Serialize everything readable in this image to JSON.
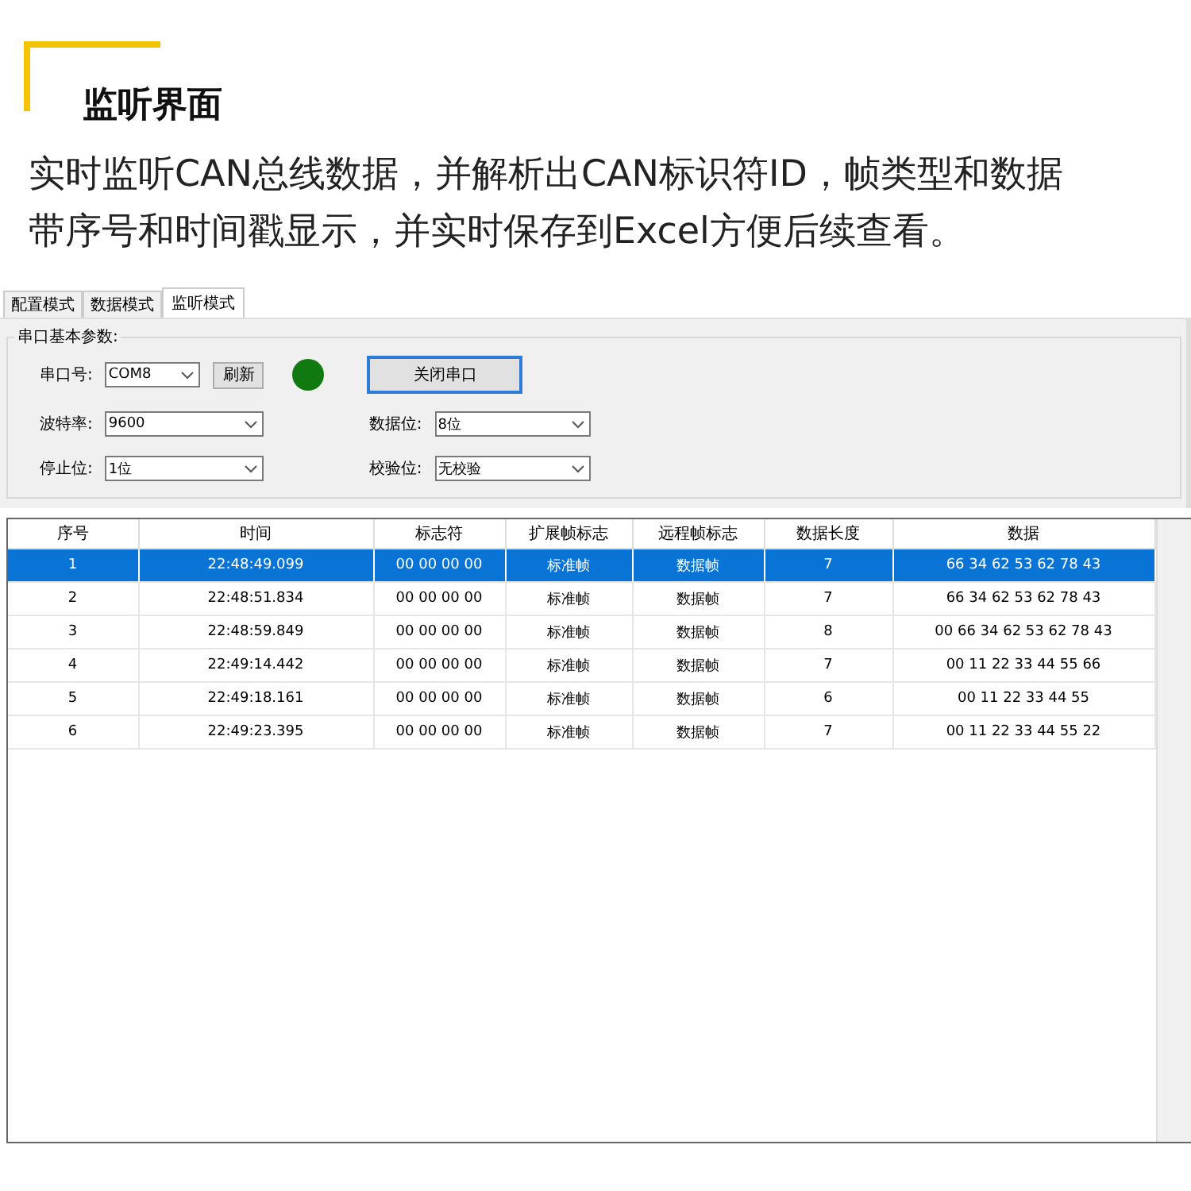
{
  "heading": {
    "title": "监听界面"
  },
  "description": {
    "lines": [
      "实时监听CAN总线数据，并解析出CAN标识符ID，帧类型和数据",
      "带序号和时间戳显示，并实时保存到Excel方便后续查看。"
    ]
  },
  "tabs": [
    {
      "label": "配置模式",
      "selected": false
    },
    {
      "label": "数据模式",
      "selected": false
    },
    {
      "label": "监听模式",
      "selected": true
    }
  ],
  "serial_group": {
    "title": "串口基本参数:",
    "port": {
      "label": "串口号:",
      "value": "COM8"
    },
    "refresh_button": "刷新",
    "connected": true,
    "close_button": "关闭串口",
    "baud_rate": {
      "label": "波特率:",
      "value": "9600"
    },
    "data_bits": {
      "label": "数据位:",
      "value": "8位"
    },
    "stop_bits": {
      "label": "停止位:",
      "value": "1位"
    },
    "parity": {
      "label": "校验位:",
      "value": "无校验"
    }
  },
  "table": {
    "columns": [
      "序号",
      "时间",
      "标志符",
      "扩展帧标志",
      "远程帧标志",
      "数据长度",
      "数据"
    ],
    "rows": [
      {
        "selected": true,
        "cells": [
          "1",
          "22:48:49.099",
          "00 00 00 00",
          "标准帧",
          "数据帧",
          "7",
          "66 34 62 53 62 78 43"
        ]
      },
      {
        "selected": false,
        "cells": [
          "2",
          "22:48:51.834",
          "00 00 00 00",
          "标准帧",
          "数据帧",
          "7",
          "66 34 62 53 62 78 43"
        ]
      },
      {
        "selected": false,
        "cells": [
          "3",
          "22:48:59.849",
          "00 00 00 00",
          "标准帧",
          "数据帧",
          "8",
          "00 66 34 62 53 62 78 43"
        ]
      },
      {
        "selected": false,
        "cells": [
          "4",
          "22:49:14.442",
          "00 00 00 00",
          "标准帧",
          "数据帧",
          "7",
          "00 11 22 33 44 55 66"
        ]
      },
      {
        "selected": false,
        "cells": [
          "5",
          "22:49:18.161",
          "00 00 00 00",
          "标准帧",
          "数据帧",
          "6",
          "00 11 22 33 44 55"
        ]
      },
      {
        "selected": false,
        "cells": [
          "6",
          "22:49:23.395",
          "00 00 00 00",
          "标准帧",
          "数据帧",
          "7",
          "00 11 22 33 44 55 22"
        ]
      }
    ]
  }
}
